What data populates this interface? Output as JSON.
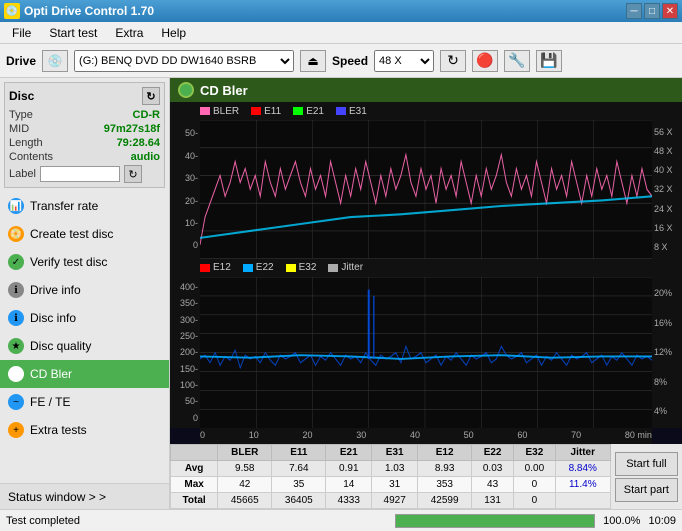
{
  "titleBar": {
    "icon": "💿",
    "title": "Opti Drive Control 1.70",
    "minimizeBtn": "─",
    "maximizeBtn": "□",
    "closeBtn": "✕"
  },
  "menuBar": {
    "items": [
      "File",
      "Start test",
      "Extra",
      "Help"
    ]
  },
  "driveBar": {
    "label": "Drive",
    "driveValue": "(G:)  BENQ DVD DD DW1640 BSRB",
    "speedLabel": "Speed",
    "speedValue": "48 X"
  },
  "disc": {
    "header": "Disc",
    "typeLabel": "Type",
    "typeValue": "CD-R",
    "midLabel": "MID",
    "midValue": "97m27s18f",
    "lengthLabel": "Length",
    "lengthValue": "79:28.64",
    "contentsLabel": "Contents",
    "contentsValue": "audio",
    "labelLabel": "Label"
  },
  "nav": {
    "items": [
      {
        "id": "transfer-rate",
        "label": "Transfer rate",
        "iconColor": "blue"
      },
      {
        "id": "create-test-disc",
        "label": "Create test disc",
        "iconColor": "orange"
      },
      {
        "id": "verify-test-disc",
        "label": "Verify test disc",
        "iconColor": "green"
      },
      {
        "id": "drive-info",
        "label": "Drive info",
        "iconColor": "gray"
      },
      {
        "id": "disc-info",
        "label": "Disc info",
        "iconColor": "blue"
      },
      {
        "id": "disc-quality",
        "label": "Disc quality",
        "iconColor": "green"
      },
      {
        "id": "cd-bler",
        "label": "CD Bler",
        "iconColor": "green",
        "active": true
      },
      {
        "id": "fe-te",
        "label": "FE / TE",
        "iconColor": "blue"
      },
      {
        "id": "extra-tests",
        "label": "Extra tests",
        "iconColor": "orange"
      }
    ],
    "statusWindow": "Status window > >"
  },
  "chart": {
    "title": "CD Bler",
    "topLegend": [
      {
        "label": "BLER",
        "color": "#ff69b4"
      },
      {
        "label": "E11",
        "color": "#ff0000"
      },
      {
        "label": "E21",
        "color": "#00ff00"
      },
      {
        "label": "E31",
        "color": "#0000ff"
      }
    ],
    "topYAxis": [
      "50-",
      "40-",
      "30-",
      "20-",
      "10-",
      "0"
    ],
    "topYAxisRight": [
      "56 X",
      "48 X",
      "40 X",
      "32 X",
      "24 X",
      "16 X",
      "8 X"
    ],
    "bottomLegend": [
      {
        "label": "E12",
        "color": "#ff0000"
      },
      {
        "label": "E22",
        "color": "#00aaff"
      },
      {
        "label": "E32",
        "color": "#ffff00"
      },
      {
        "label": "Jitter",
        "color": "#aaaaaa"
      }
    ],
    "bottomYAxis": [
      "400-",
      "350-",
      "300-",
      "250-",
      "200-",
      "150-",
      "100-",
      "50-",
      "0"
    ],
    "bottomYAxisRight": [
      "20%",
      "16%",
      "12%",
      "8%",
      "4%"
    ],
    "xAxisLabels": [
      "0",
      "10",
      "20",
      "30",
      "40",
      "50",
      "60",
      "70",
      "80 min"
    ]
  },
  "stats": {
    "headers": [
      "",
      "BLER",
      "E11",
      "E21",
      "E31",
      "E12",
      "E22",
      "E32",
      "Jitter"
    ],
    "rows": [
      {
        "label": "Avg",
        "values": [
          "9.58",
          "7.64",
          "0.91",
          "1.03",
          "8.93",
          "0.03",
          "0.00",
          "8.84%"
        ]
      },
      {
        "label": "Max",
        "values": [
          "42",
          "35",
          "14",
          "31",
          "353",
          "43",
          "0",
          "11.4%"
        ]
      },
      {
        "label": "Total",
        "values": [
          "45665",
          "36405",
          "4333",
          "4927",
          "42599",
          "131",
          "0",
          ""
        ]
      }
    ],
    "buttons": {
      "startFull": "Start full",
      "startPart": "Start part"
    }
  },
  "statusBar": {
    "text": "Test completed",
    "progress": 100,
    "progressText": "100.0%",
    "time": "10:09"
  }
}
